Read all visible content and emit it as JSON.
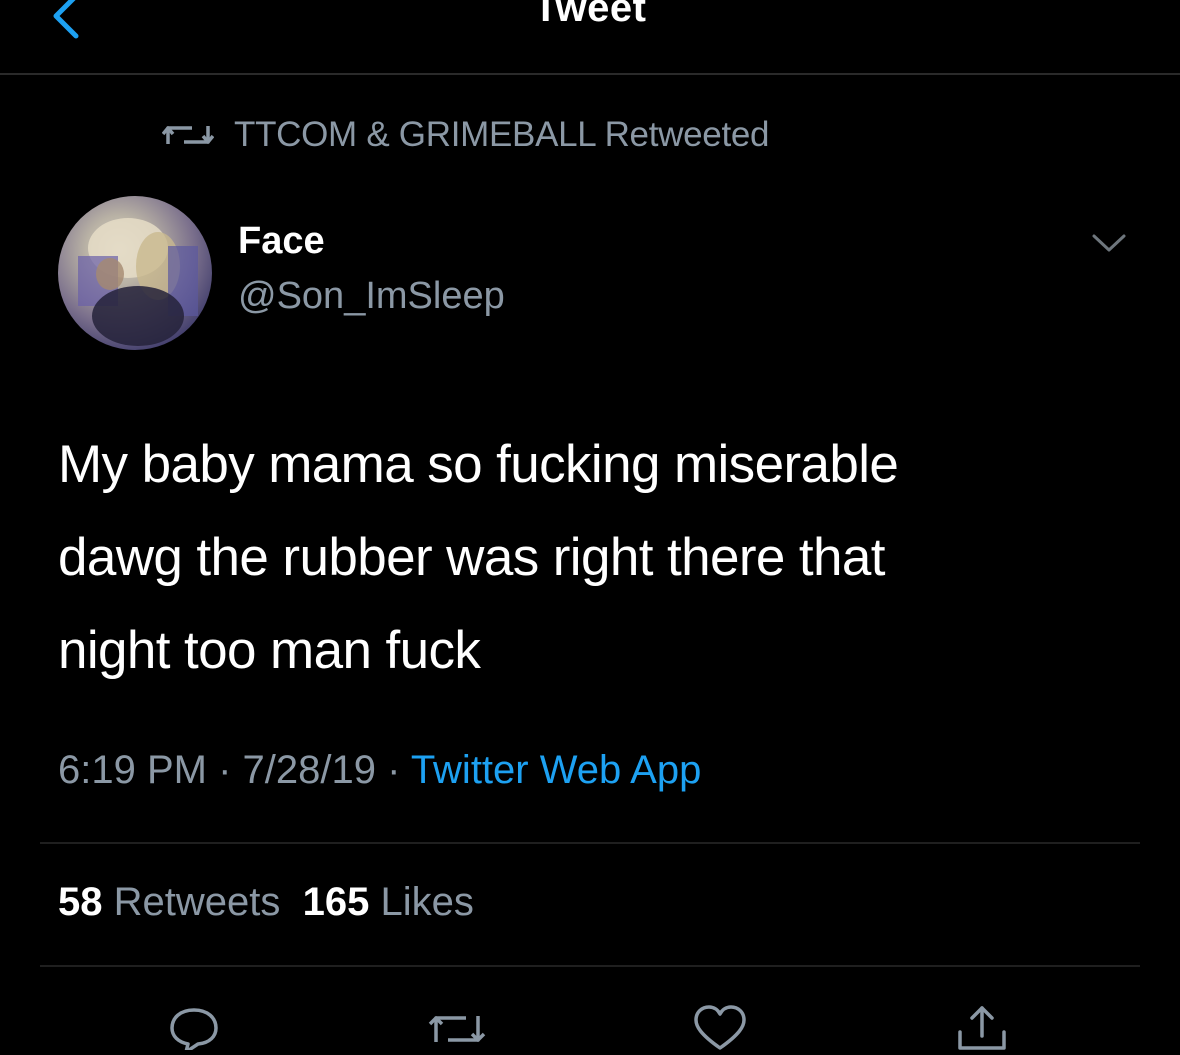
{
  "header": {
    "title": "Tweet"
  },
  "retweet_context": {
    "icon": "retweet-icon",
    "text": "TTCOM & GRIMEBALL Retweeted"
  },
  "author": {
    "name": "Face",
    "handle": "@Son_ImSleep"
  },
  "tweet": {
    "text": "My baby mama so fucking miserable\ndawg the rubber was right there that\nnight too man fuck",
    "time": "6:19 PM",
    "separator": " · ",
    "date": "7/28/19",
    "source": "Twitter Web App"
  },
  "stats": {
    "retweets_count": "58",
    "retweets_label": "Retweets",
    "likes_count": "165",
    "likes_label": "Likes"
  },
  "colors": {
    "background": "#000000",
    "text": "#ffffff",
    "secondary_text": "#8b98a5",
    "accent": "#1da1f2"
  },
  "actions": [
    {
      "icon": "reply-icon"
    },
    {
      "icon": "retweet-icon"
    },
    {
      "icon": "like-icon"
    },
    {
      "icon": "share-icon"
    }
  ]
}
